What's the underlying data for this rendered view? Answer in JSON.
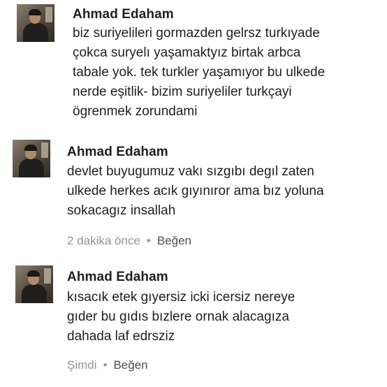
{
  "comments": [
    {
      "author": "Ahmad Edaham",
      "text": "biz suriyelileri gormazden gelrsz turkıyade\nçokca suryelı yaşamaktyız birtak arbca\ntabale yok. tek turkler yaşamıyor bu ulkede\nnerde eşitlik- bizim suriyeliler turkçayi\nögrenmek zorundami",
      "time": "",
      "like_label": ""
    },
    {
      "author": "Ahmad Edaham",
      "text": "devlet buyugumuz vakı sızgıbı degıl zaten\nulkede herkes acık gıyınıror ama bız yoluna\nsokacagız insallah",
      "time": "2 dakika önce",
      "like_label": "Beğen"
    },
    {
      "author": "Ahmad Edaham",
      "text": "kısacık etek gıyersiz icki icersiz nereye\ngıder bu gıdıs bızlere ornak alacagıza\ndahada laf edrsziz",
      "time": "Şimdi",
      "like_label": "Beğen"
    }
  ],
  "separator": "•"
}
